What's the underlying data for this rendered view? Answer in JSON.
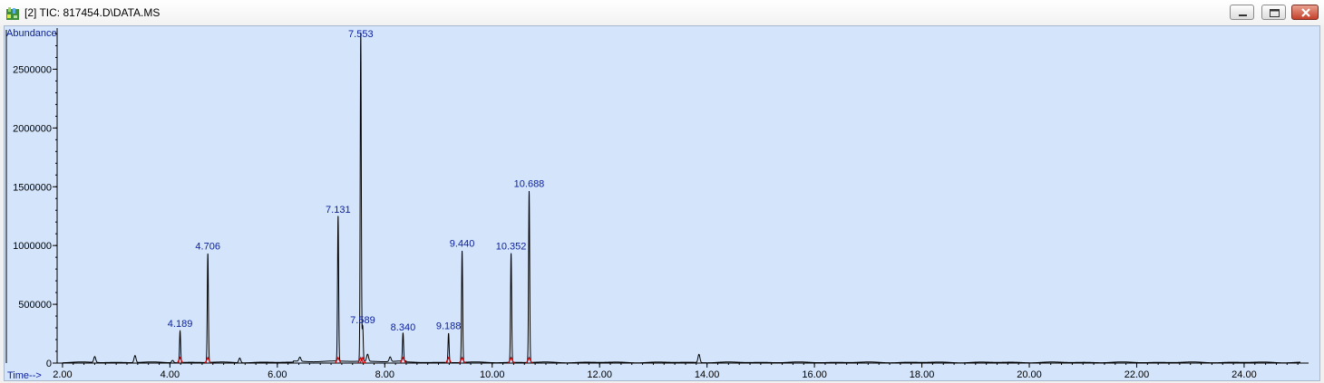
{
  "window": {
    "title": "[2] TIC: 817454.D\\DATA.MS",
    "icon": "chromatogram-app-icon",
    "controls": [
      "minimize-icon",
      "restore-icon",
      "close-icon"
    ]
  },
  "colors": {
    "plot_background": "#d3e4fb",
    "trace": "#000000",
    "integration_marks": "#d40000",
    "peak_labels": "#0a1e9c"
  },
  "chart_data": {
    "type": "line",
    "ylabel": "Abundance",
    "xlabel": "Time-->",
    "xlim": [
      1.9,
      25.2
    ],
    "ylim": [
      0,
      2850000
    ],
    "x_ticks": [
      2,
      4,
      6,
      8,
      10,
      12,
      14,
      16,
      18,
      20,
      22,
      24
    ],
    "x_tick_labels": [
      "2.00",
      "4.00",
      "6.00",
      "8.00",
      "10.00",
      "12.00",
      "14.00",
      "16.00",
      "18.00",
      "20.00",
      "22.00",
      "24.00"
    ],
    "y_ticks": [
      0,
      500000,
      1000000,
      1500000,
      2000000,
      2500000
    ],
    "y_tick_labels": [
      "0",
      "500000",
      "1000000",
      "1500000",
      "2000000",
      "2500000"
    ],
    "grid": false,
    "labeled_peaks": [
      {
        "label": "4.189",
        "rt": 4.189,
        "height": 270000
      },
      {
        "label": "4.706",
        "rt": 4.706,
        "height": 930000
      },
      {
        "label": "7.131",
        "rt": 7.131,
        "height": 1240000
      },
      {
        "label": "7.553",
        "rt": 7.553,
        "height": 2800000
      },
      {
        "label": "7.589",
        "rt": 7.589,
        "height": 300000
      },
      {
        "label": "8.340",
        "rt": 8.34,
        "height": 240000
      },
      {
        "label": "9.188",
        "rt": 9.188,
        "height": 250000
      },
      {
        "label": "9.440",
        "rt": 9.44,
        "height": 950000
      },
      {
        "label": "10.352",
        "rt": 10.352,
        "height": 930000
      },
      {
        "label": "10.688",
        "rt": 10.688,
        "height": 1460000
      }
    ],
    "minor_peaks": [
      {
        "rt": 2.6,
        "height": 50000
      },
      {
        "rt": 3.35,
        "height": 60000
      },
      {
        "rt": 4.05,
        "height": 20000
      },
      {
        "rt": 5.3,
        "height": 40000
      },
      {
        "rt": 6.42,
        "height": 35000
      },
      {
        "rt": 7.68,
        "height": 60000
      },
      {
        "rt": 8.1,
        "height": 40000
      },
      {
        "rt": 13.85,
        "height": 70000
      }
    ]
  }
}
